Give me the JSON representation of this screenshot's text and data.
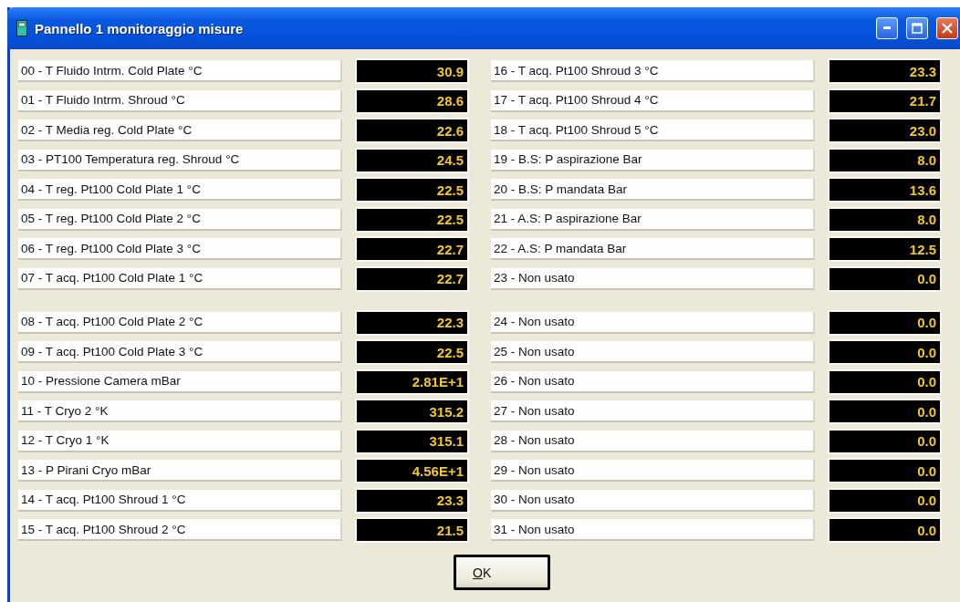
{
  "window": {
    "title": "Pannello 1 monitoraggio misure"
  },
  "columns": [
    {
      "groups": [
        {
          "rows": [
            {
              "label": "00 - T Fluido Intrm. Cold Plate °C",
              "value": "30.9"
            },
            {
              "label": "01 - T Fluido Intrm. Shroud °C",
              "value": "28.6"
            },
            {
              "label": "02 - T Media reg. Cold Plate °C",
              "value": "22.6"
            },
            {
              "label": "03 - PT100 Temperatura reg. Shroud °C",
              "value": "24.5"
            },
            {
              "label": "04 - T reg. Pt100 Cold Plate 1 °C",
              "value": "22.5"
            },
            {
              "label": "05 - T reg. Pt100 Cold Plate 2 °C",
              "value": "22.5"
            },
            {
              "label": "06 - T reg. Pt100 Cold Plate 3 °C",
              "value": "22.7"
            },
            {
              "label": "07 - T acq. Pt100 Cold Plate 1 °C",
              "value": "22.7"
            }
          ]
        },
        {
          "rows": [
            {
              "label": "08 - T acq. Pt100 Cold Plate 2 °C",
              "value": "22.3"
            },
            {
              "label": "09 - T acq. Pt100 Cold Plate 3 °C",
              "value": "22.5"
            },
            {
              "label": "10 - Pressione Camera mBar",
              "value": "2.81E+1"
            },
            {
              "label": "11 - T Cryo 2 °K",
              "value": "315.2"
            },
            {
              "label": "12 - T Cryo 1 °K",
              "value": "315.1"
            },
            {
              "label": "13 - P Pirani Cryo mBar",
              "value": "4.56E+1"
            },
            {
              "label": "14 - T acq. Pt100 Shroud 1 °C",
              "value": "23.3"
            },
            {
              "label": "15 - T acq. Pt100 Shroud 2 °C",
              "value": "21.5"
            }
          ]
        }
      ]
    },
    {
      "groups": [
        {
          "rows": [
            {
              "label": "16 - T acq. Pt100 Shroud 3 °C",
              "value": "23.3"
            },
            {
              "label": "17 - T acq. Pt100 Shroud 4 °C",
              "value": "21.7"
            },
            {
              "label": "18 - T acq. Pt100 Shroud 5 °C",
              "value": "23.0"
            },
            {
              "label": "19 - B.S: P aspirazione Bar",
              "value": "8.0"
            },
            {
              "label": "20 - B.S: P mandata Bar",
              "value": "13.6"
            },
            {
              "label": "21 - A.S: P aspirazione Bar",
              "value": "8.0"
            },
            {
              "label": "22 - A.S: P mandata Bar",
              "value": "12.5"
            },
            {
              "label": "23 - Non usato",
              "value": "0.0"
            }
          ]
        },
        {
          "rows": [
            {
              "label": "24 - Non usato",
              "value": "0.0"
            },
            {
              "label": "25 - Non usato",
              "value": "0.0"
            },
            {
              "label": "26 - Non usato",
              "value": "0.0"
            },
            {
              "label": "27 - Non usato",
              "value": "0.0"
            },
            {
              "label": "28 - Non usato",
              "value": "0.0"
            },
            {
              "label": "29 - Non usato",
              "value": "0.0"
            },
            {
              "label": "30 - Non usato",
              "value": "0.0"
            },
            {
              "label": "31 - Non usato",
              "value": "0.0"
            }
          ]
        }
      ]
    }
  ],
  "ok_button": {
    "label": "OK"
  }
}
